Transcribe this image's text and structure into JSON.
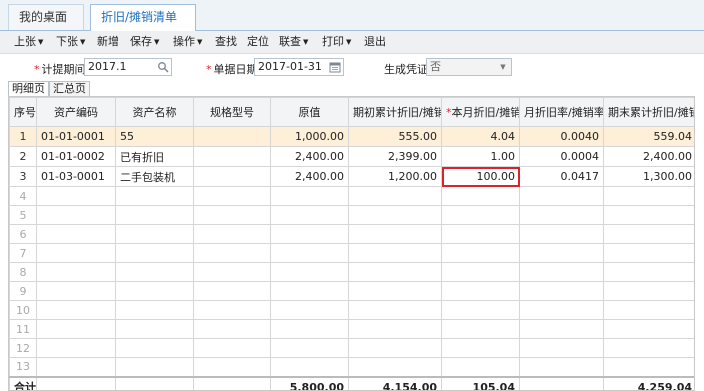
{
  "tabs": [
    {
      "label": "我的桌面"
    },
    {
      "label": "折旧/摊销清单",
      "close": "×"
    }
  ],
  "toolbar": {
    "up": "上张",
    "down": "下张",
    "new": "新增",
    "save": "保存",
    "ops": "操作",
    "find": "查找",
    "locate": "定位",
    "link": "联查",
    "print": "打印",
    "exit": "退出"
  },
  "form": {
    "period_label": "计提期间",
    "period_value": "2017.1",
    "date_label": "单据日期",
    "date_value": "2017-01-31",
    "voucher_label": "生成凭证",
    "voucher_value": "否"
  },
  "subtabs": [
    "明细页",
    "汇总页"
  ],
  "columns": [
    "序号",
    "资产编码",
    "资产名称",
    "规格型号",
    "原值",
    "期初累计折旧/摊销",
    "本月折旧/摊销",
    "月折旧率/摊销率",
    "期末累计折旧/摊销"
  ],
  "rows": [
    [
      "1",
      "01-01-0001",
      "55",
      "",
      "1,000.00",
      "555.00",
      "4.04",
      "0.0040",
      "559.04"
    ],
    [
      "2",
      "01-01-0002",
      "已有折旧",
      "",
      "2,400.00",
      "2,399.00",
      "1.00",
      "0.0004",
      "2,400.00"
    ],
    [
      "3",
      "01-03-0001",
      "二手包装机",
      "",
      "2,400.00",
      "1,200.00",
      "100.00",
      "0.0417",
      "1,300.00"
    ]
  ],
  "empty_rows": [
    "4",
    "5",
    "6",
    "7",
    "8",
    "9",
    "10",
    "11",
    "12",
    "13"
  ],
  "total": {
    "label": "合计",
    "original": "5,800.00",
    "opening": "4,154.00",
    "month": "105.04",
    "ending": "4,259.04"
  }
}
